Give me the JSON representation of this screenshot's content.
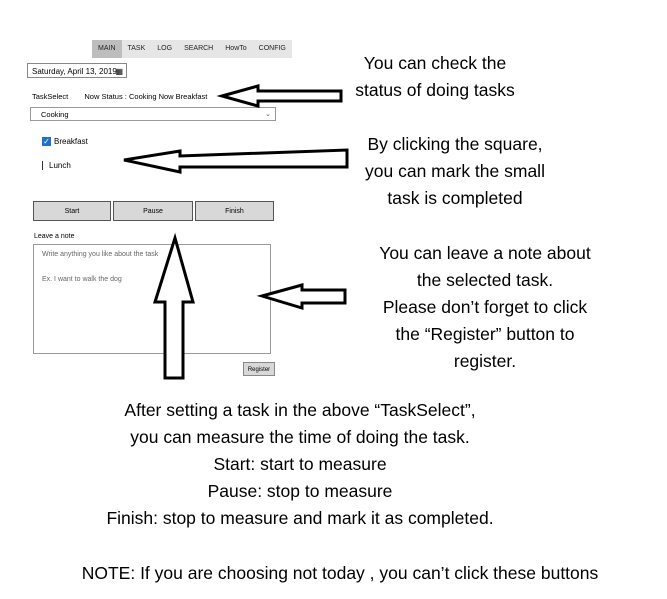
{
  "nav": {
    "tabs": [
      {
        "label": "MAIN"
      },
      {
        "label": "TASK"
      },
      {
        "label": "LOG"
      },
      {
        "label": "SEARCH"
      },
      {
        "label": "HowTo"
      },
      {
        "label": "CONFIG"
      }
    ]
  },
  "date": {
    "value": "Saturday, April 13, 2019"
  },
  "task_select": {
    "label": "TaskSelect",
    "status": "Now Status : Cooking Now Breakfast",
    "selected": "Cooking"
  },
  "subtasks": [
    {
      "label": "Breakfast",
      "checked": true
    },
    {
      "label": "Lunch",
      "checked": false
    }
  ],
  "buttons": {
    "start": "Start",
    "pause": "Pause",
    "finish": "Finish",
    "register": "Register"
  },
  "note": {
    "label": "Leave a note",
    "placeholder": "Write anything you like about the task",
    "line2": "Ex. I want to walk the dog"
  },
  "captions": {
    "status": [
      "You can check the",
      "status of doing tasks"
    ],
    "square": [
      "By clicking the square,",
      "you can mark the small",
      "task is completed"
    ],
    "note": [
      "You can leave a note about",
      "the selected task.",
      "Please don’t forget to click",
      "the “Register” button to",
      "register."
    ],
    "buttons": [
      "After setting a task in the above “TaskSelect”,",
      "you can measure the time of doing the task.",
      "Start: start to measure",
      "Pause: stop to measure",
      "Finish: stop to measure and mark it as completed."
    ],
    "notice": "NOTE: If you are choosing not today , you can’t click these  buttons"
  },
  "colors": {
    "checkbox": "#1e72c8",
    "button_bg": "#d8d8d8"
  }
}
